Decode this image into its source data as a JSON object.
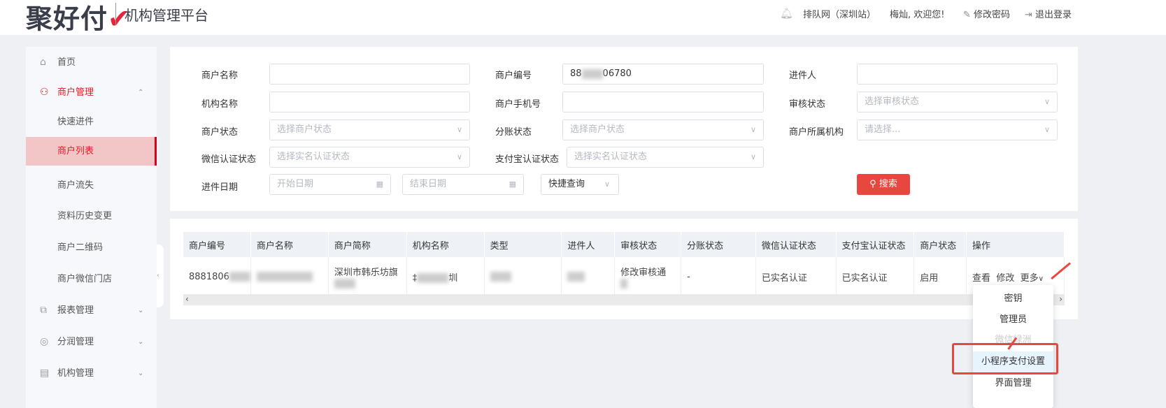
{
  "header": {
    "logo": "聚好付",
    "title": "机构管理平台",
    "org": "排队网（深圳站）",
    "welcome": "梅灿, 欢迎您!",
    "change_password": "修改密码",
    "logout": "退出登录"
  },
  "sidebar": {
    "items": [
      {
        "label": "首页",
        "icon": "home-icon"
      },
      {
        "label": "商户管理",
        "icon": "merchant-icon",
        "expanded": true
      },
      {
        "label": "快速进件"
      },
      {
        "label": "商户列表",
        "active": true
      },
      {
        "label": "商户流失"
      },
      {
        "label": "资料历史变更"
      },
      {
        "label": "商户二维码"
      },
      {
        "label": "商户微信门店"
      },
      {
        "label": "报表管理",
        "icon": "report-icon"
      },
      {
        "label": "分润管理",
        "icon": "profit-icon"
      },
      {
        "label": "机构管理",
        "icon": "org-icon"
      }
    ]
  },
  "filters": {
    "merchant_name": {
      "label": "商户名称",
      "value": ""
    },
    "merchant_no": {
      "label": "商户编号",
      "value_prefix": "88",
      "value_suffix": "06780"
    },
    "applicant": {
      "label": "进件人",
      "value": ""
    },
    "org_name": {
      "label": "机构名称",
      "value": ""
    },
    "merchant_phone": {
      "label": "商户手机号",
      "value": ""
    },
    "audit_status": {
      "label": "审核状态",
      "placeholder": "选择审核状态"
    },
    "merchant_status": {
      "label": "商户状态",
      "placeholder": "选择商户状态"
    },
    "split_status": {
      "label": "分账状态",
      "placeholder": "选择商户状态"
    },
    "merchant_org": {
      "label": "商户所属机构",
      "placeholder": "请选择..."
    },
    "wechat_auth": {
      "label": "微信认证状态",
      "placeholder": "选择实名认证状态"
    },
    "alipay_auth": {
      "label": "支付宝认证状态",
      "placeholder": "选择实名认证状态"
    },
    "date": {
      "label": "进件日期",
      "start_placeholder": "开始日期",
      "end_placeholder": "结束日期"
    },
    "quick_query": "快捷查询",
    "search": "搜索"
  },
  "table": {
    "columns": [
      "商户编号",
      "商户名称",
      "商户简称",
      "机构名称",
      "类型",
      "进件人",
      "审核状态",
      "分账状态",
      "微信认证状态",
      "支付宝认证状态",
      "商户状态",
      "操作"
    ],
    "row": {
      "merchant_no": "8881806",
      "short_name": "深圳市韩乐坊旗",
      "org_name_a": "‡",
      "org_name_b": "圳",
      "audit": "修改审核通",
      "split": "-",
      "wechat": "已实名认证",
      "alipay": "已实名认证",
      "status": "启用",
      "view": "查看",
      "edit": "修改",
      "more": "更多"
    }
  },
  "more_menu": {
    "items": [
      "密钥",
      "管理员",
      "微信绿洲",
      "小程序支付设置",
      "界面管理"
    ],
    "highlighted": "小程序支付设置"
  },
  "colors": {
    "accent": "#e0202a",
    "button": "#e8473f",
    "annotation": "#e8473f"
  }
}
